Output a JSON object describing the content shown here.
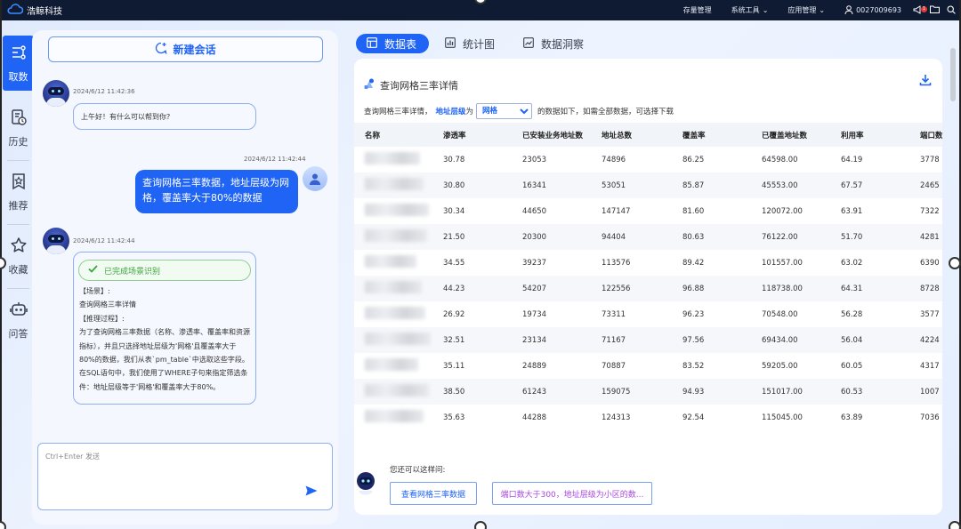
{
  "app": {
    "brand": "浩鲸科技",
    "top_menu": [
      {
        "label": "存量管理",
        "has_caret": false
      },
      {
        "label": "系统工具",
        "has_caret": true
      },
      {
        "label": "应用管理",
        "has_caret": true
      }
    ],
    "user_id": "0027009693",
    "notification_count": "1"
  },
  "left_nav": [
    {
      "label": "取数",
      "icon": "data-fetch-icon",
      "active": true
    },
    {
      "label": "历史",
      "icon": "history-icon",
      "active": false
    },
    {
      "label": "推荐",
      "icon": "recommend-icon",
      "active": false
    },
    {
      "label": "收藏",
      "icon": "star-icon",
      "active": false
    },
    {
      "label": "问答",
      "icon": "robot-icon",
      "active": false
    }
  ],
  "chat": {
    "new_chat_label": "新建会话",
    "messages": [
      {
        "role": "bot",
        "time": "2024/6/12 11:42:36",
        "text": "上午好！有什么可以帮到你?"
      },
      {
        "role": "user",
        "time": "2024/6/12 11:42:44",
        "text": "查询网格三率数据，地址层级为网格，覆盖率大于80%的数据"
      },
      {
        "role": "bot",
        "time": "2024/6/12 11:42:44",
        "status": "已完成场景识别",
        "lines": [
          "【场景】:",
          "查询网格三率详情",
          "【推理过程】:",
          "为了查询网格三率数据（名称、渗透率、覆盖率和资源指标），并且只选择地址层级为'网格'且覆盖率大于80%的数据，我们从表`pm_table`中选取这些字段。在SQL语句中，我们使用了WHERE子句来指定筛选条件：地址层级等于'网格'和覆盖率大于80%。"
        ]
      }
    ],
    "input_placeholder": "Ctrl+Enter 发送"
  },
  "tabs": [
    {
      "label": "数据表",
      "icon": "table-icon",
      "active": true
    },
    {
      "label": "统计图",
      "icon": "bar-chart-icon",
      "active": false
    },
    {
      "label": "数据洞察",
      "icon": "insight-icon",
      "active": false
    }
  ],
  "result": {
    "title": "查询网格三率详情",
    "filter_prefix": "查询网格三率详情，",
    "filter_level_label": "地址层级",
    "filter_mid": "为",
    "filter_selected": "网格",
    "filter_suffix": "的数据如下，如需全部数据，可选择下载",
    "columns": [
      "名称",
      "渗透率",
      "已安装业务地址数",
      "地址总数",
      "覆盖率",
      "已覆盖地址数",
      "利用率",
      "端口数"
    ],
    "rows": [
      [
        "",
        "30.78",
        "23053",
        "74896",
        "86.25",
        "64598.00",
        "64.19",
        "3778"
      ],
      [
        "",
        "30.80",
        "16341",
        "53051",
        "85.87",
        "45553.00",
        "67.57",
        "2465"
      ],
      [
        "",
        "30.34",
        "44650",
        "147147",
        "81.60",
        "120072.00",
        "63.91",
        "7322"
      ],
      [
        "",
        "21.50",
        "20300",
        "94404",
        "80.63",
        "76122.00",
        "51.70",
        "4281"
      ],
      [
        "",
        "34.55",
        "39237",
        "113576",
        "89.42",
        "101557.00",
        "63.02",
        "6390"
      ],
      [
        "",
        "44.23",
        "54207",
        "122556",
        "96.88",
        "118738.00",
        "64.31",
        "8728"
      ],
      [
        "",
        "26.92",
        "19734",
        "73311",
        "96.23",
        "70548.00",
        "56.28",
        "3577"
      ],
      [
        "",
        "32.51",
        "23134",
        "71167",
        "97.56",
        "69434.00",
        "56.04",
        "4224"
      ],
      [
        "",
        "35.11",
        "24889",
        "70887",
        "83.52",
        "59205.00",
        "60.05",
        "4317"
      ],
      [
        "",
        "38.50",
        "61243",
        "159075",
        "94.93",
        "151017.00",
        "60.53",
        "1007"
      ],
      [
        "",
        "35.63",
        "44288",
        "124313",
        "92.54",
        "115045.00",
        "63.89",
        "7036"
      ]
    ],
    "suggest_label": "您还可以这样问:",
    "suggestions": [
      "查看网格三率数据",
      "端口数大于300，地址层级为小区的数..."
    ]
  }
}
